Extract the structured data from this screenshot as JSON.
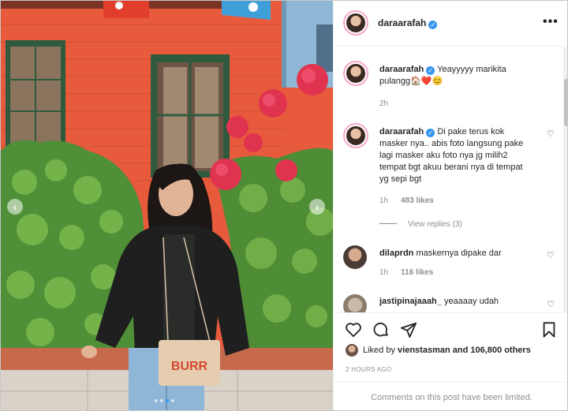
{
  "post": {
    "username": "daraarafah",
    "more_label": "•••"
  },
  "photo": {
    "prev_label": "‹",
    "next_label": "›",
    "bag_text": "BURR"
  },
  "comments": [
    {
      "username": "daraarafah",
      "text": "Yeayyyyy marikita pulangg🏠❤️😊",
      "time": "2h"
    },
    {
      "username": "daraarafah",
      "text": "Di pake terus kok masker nya.. abis foto langsung pake lagi masker aku foto nya jg milih2 tempat bgt akuu berani nya di tempat yg sepi bgt",
      "time": "1h",
      "likes": "483 likes",
      "view_replies": "View replies (3)"
    },
    {
      "username": "dilaprdn",
      "text": "maskernya dipake dar",
      "time": "1h",
      "likes": "116 likes"
    },
    {
      "username": "jastipinajaaah_",
      "text": "yeaaaay udah"
    }
  ],
  "likes_line": {
    "prefix": "Liked by",
    "user": "vienstasman",
    "suffix": "and 106,800 others"
  },
  "timestamp": "2 HOURS AGO",
  "comments_limited": "Comments on this post have been limited.",
  "icons": [
    "heart-icon",
    "comment-icon",
    "share-icon",
    "bookmark-icon",
    "verified-icon",
    "more-icon"
  ],
  "colors": {
    "verified": "#3897f0",
    "wall": "#e9573b",
    "muted": "#8e8e8e"
  }
}
